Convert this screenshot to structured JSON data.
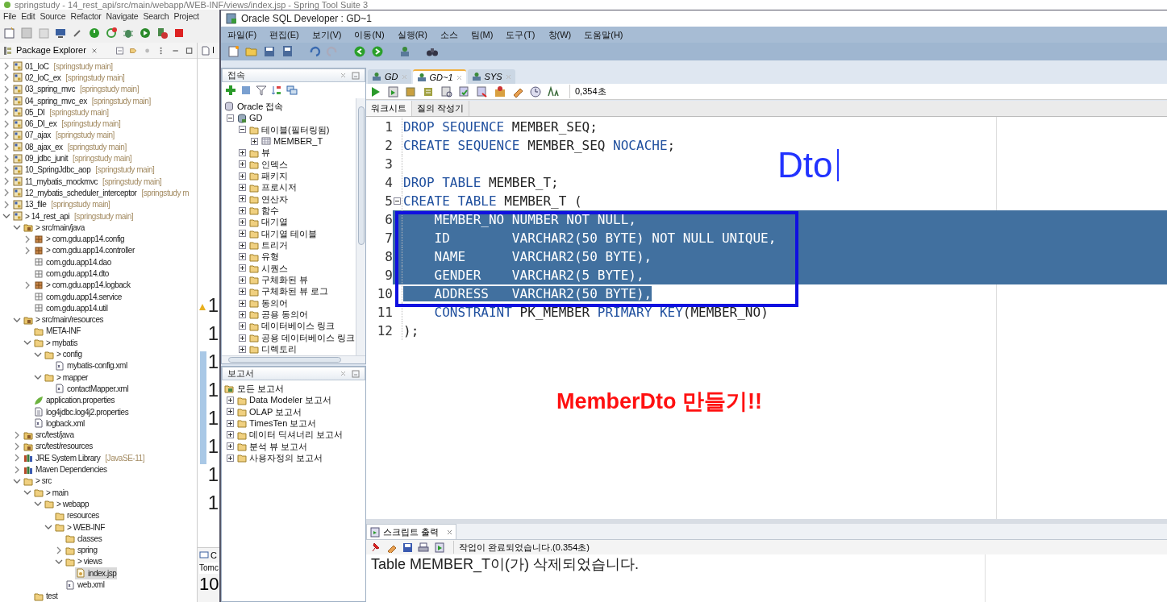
{
  "sts": {
    "title": "springstudy - 14_rest_api/src/main/webapp/WEB-INF/views/index.jsp - Spring Tool Suite 3",
    "menu": [
      "File",
      "Edit",
      "Source",
      "Refactor",
      "Navigate",
      "Search",
      "Project"
    ],
    "explorer_tab": "Package Explorer",
    "tree": [
      {
        "label": "01_IoC",
        "decoration": "[springstudy main]",
        "kind": "project",
        "expanded": false,
        "selected": false
      },
      {
        "label": "02_IoC_ex",
        "decoration": "[springstudy main]",
        "kind": "project",
        "expanded": false,
        "selected": false
      },
      {
        "label": "03_spring_mvc",
        "decoration": "[springstudy main]",
        "kind": "project",
        "expanded": false,
        "selected": false
      },
      {
        "label": "04_spring_mvc_ex",
        "decoration": "[springstudy main]",
        "kind": "project",
        "expanded": false,
        "selected": false
      },
      {
        "label": "05_DI",
        "decoration": "[springstudy main]",
        "kind": "project",
        "expanded": false,
        "selected": false
      },
      {
        "label": "06_DI_ex",
        "decoration": "[springstudy main]",
        "kind": "project",
        "expanded": false,
        "selected": false
      },
      {
        "label": "07_ajax",
        "decoration": "[springstudy main]",
        "kind": "project",
        "expanded": false,
        "selected": false
      },
      {
        "label": "08_ajax_ex",
        "decoration": "[springstudy main]",
        "kind": "project",
        "expanded": false,
        "selected": false
      },
      {
        "label": "09_jdbc_junit",
        "decoration": "[springstudy main]",
        "kind": "project",
        "expanded": false,
        "selected": false
      },
      {
        "label": "10_SpringJdbc_aop",
        "decoration": "[springstudy main]",
        "kind": "project",
        "expanded": false,
        "selected": false
      },
      {
        "label": "11_mybatis_mockmvc",
        "decoration": "[springstudy main]",
        "kind": "project",
        "expanded": false,
        "selected": false
      },
      {
        "label": "12_mybatis_scheduler_interceptor",
        "decoration": "[springstudy m",
        "kind": "project",
        "expanded": false,
        "selected": false
      },
      {
        "label": "13_file",
        "decoration": "[springstudy main]",
        "kind": "project",
        "expanded": false,
        "selected": false
      },
      {
        "label": "> 14_rest_api",
        "decoration": "[springstudy main]",
        "kind": "project",
        "expanded": true,
        "selected": false,
        "children": [
          {
            "label": "> src/main/java",
            "kind": "source-folder",
            "expanded": true,
            "selected": false,
            "children": [
              {
                "label": "> com.gdu.app14.config",
                "kind": "package",
                "expanded": false,
                "selected": false
              },
              {
                "label": "> com.gdu.app14.controller",
                "kind": "package",
                "expanded": false,
                "selected": false
              },
              {
                "label": "com.gdu.app14.dao",
                "kind": "package-empty",
                "selected": false
              },
              {
                "label": "com.gdu.app14.dto",
                "kind": "package-empty",
                "selected": false
              },
              {
                "label": "> com.gdu.app14.logback",
                "kind": "package",
                "expanded": false,
                "selected": false
              },
              {
                "label": "com.gdu.app14.service",
                "kind": "package-empty",
                "selected": false
              },
              {
                "label": "com.gdu.app14.util",
                "kind": "package-empty",
                "selected": false
              }
            ]
          },
          {
            "label": "> src/main/resources",
            "kind": "source-folder",
            "expanded": true,
            "selected": false,
            "children": [
              {
                "label": "META-INF",
                "kind": "folder",
                "selected": false
              },
              {
                "label": "> mybatis",
                "kind": "folder",
                "expanded": true,
                "selected": false,
                "children": [
                  {
                    "label": "> config",
                    "kind": "folder",
                    "expanded": true,
                    "selected": false,
                    "children": [
                      {
                        "label": "mybatis-config.xml",
                        "kind": "xml",
                        "selected": false
                      }
                    ]
                  },
                  {
                    "label": "> mapper",
                    "kind": "folder",
                    "expanded": true,
                    "selected": false,
                    "children": [
                      {
                        "label": "contactMapper.xml",
                        "kind": "xml",
                        "selected": false
                      }
                    ]
                  }
                ]
              },
              {
                "label": "application.properties",
                "kind": "spring",
                "selected": false
              },
              {
                "label": "log4jdbc.log4j2.properties",
                "kind": "properties",
                "selected": false
              },
              {
                "label": "logback.xml",
                "kind": "xml",
                "selected": false
              }
            ]
          },
          {
            "label": "src/test/java",
            "kind": "source-folder",
            "expanded": false,
            "selected": false
          },
          {
            "label": "src/test/resources",
            "kind": "source-folder",
            "expanded": false,
            "selected": false
          },
          {
            "label": "JRE System Library",
            "decoration": "[JavaSE-11]",
            "kind": "library",
            "expanded": false,
            "selected": false
          },
          {
            "label": "Maven Dependencies",
            "kind": "library",
            "expanded": false,
            "selected": false
          },
          {
            "label": "> src",
            "kind": "folder",
            "expanded": true,
            "selected": false,
            "children": [
              {
                "label": "> main",
                "kind": "folder",
                "expanded": true,
                "selected": false,
                "children": [
                  {
                    "label": "> webapp",
                    "kind": "folder",
                    "expanded": true,
                    "selected": false,
                    "children": [
                      {
                        "label": "resources",
                        "kind": "folder",
                        "selected": false
                      },
                      {
                        "label": "> WEB-INF",
                        "kind": "folder",
                        "expanded": true,
                        "selected": false,
                        "children": [
                          {
                            "label": "classes",
                            "kind": "folder",
                            "selected": false
                          },
                          {
                            "label": "spring",
                            "kind": "folder",
                            "expanded": false,
                            "selected": false
                          },
                          {
                            "label": "> views",
                            "kind": "folder",
                            "expanded": true,
                            "selected": false,
                            "children": [
                              {
                                "label": "index.jsp",
                                "kind": "jsp",
                                "selected": true
                              }
                            ]
                          },
                          {
                            "label": "web.xml",
                            "kind": "xml",
                            "selected": false
                          }
                        ]
                      }
                    ]
                  }
                ]
              },
              {
                "label": "test",
                "kind": "folder",
                "selected": false
              }
            ]
          }
        ]
      }
    ],
    "editor_tab": "I",
    "gutter_numbers": [
      "1",
      "1",
      "1",
      "1",
      "1",
      "1",
      "1",
      "1"
    ],
    "console_view_tab": "C",
    "console_tab": "Tomc",
    "console_text": "10"
  },
  "sql": {
    "title": "Oracle SQL Developer : GD~1",
    "menu": [
      "파일(F)",
      "편집(E)",
      "보기(V)",
      "이동(N)",
      "실행(R)",
      "소스",
      "팀(M)",
      "도구(T)",
      "창(W)",
      "도움말(H)"
    ],
    "connections": {
      "title": "접속",
      "root": "Oracle 접속",
      "tree": [
        {
          "label": "GD",
          "kind": "connection",
          "expanded": true,
          "selected": false,
          "children": [
            {
              "label": "테이블(필터링됨)",
              "kind": "folder",
              "expanded": true,
              "selected": false,
              "children": [
                {
                  "label": "MEMBER_T",
                  "kind": "table",
                  "expanded": false,
                  "selected": false
                }
              ]
            },
            {
              "label": "뷰",
              "kind": "folder",
              "expanded": false,
              "selected": false
            },
            {
              "label": "인덱스",
              "kind": "folder",
              "expanded": false,
              "selected": false
            },
            {
              "label": "패키지",
              "kind": "folder",
              "expanded": false,
              "selected": false
            },
            {
              "label": "프로시저",
              "kind": "folder",
              "expanded": false,
              "selected": false
            },
            {
              "label": "연산자",
              "kind": "folder",
              "expanded": false,
              "selected": false
            },
            {
              "label": "함수",
              "kind": "folder",
              "expanded": false,
              "selected": false
            },
            {
              "label": "대기열",
              "kind": "folder",
              "expanded": false,
              "selected": false
            },
            {
              "label": "대기열 테이블",
              "kind": "folder",
              "expanded": false,
              "selected": false
            },
            {
              "label": "트리거",
              "kind": "folder",
              "expanded": false,
              "selected": false
            },
            {
              "label": "유형",
              "kind": "folder",
              "expanded": false,
              "selected": false
            },
            {
              "label": "시퀀스",
              "kind": "folder",
              "expanded": false,
              "selected": false
            },
            {
              "label": "구체화된 뷰",
              "kind": "folder",
              "expanded": false,
              "selected": false
            },
            {
              "label": "구체화된 뷰 로그",
              "kind": "folder",
              "expanded": false,
              "selected": false
            },
            {
              "label": "동의어",
              "kind": "folder",
              "expanded": false,
              "selected": false
            },
            {
              "label": "공용 동의어",
              "kind": "folder",
              "expanded": false,
              "selected": false
            },
            {
              "label": "데이터베이스 링크",
              "kind": "folder",
              "expanded": false,
              "selected": false
            },
            {
              "label": "공용 데이터베이스 링크",
              "kind": "folder",
              "expanded": false,
              "selected": false
            },
            {
              "label": "디렉토리",
              "kind": "folder",
              "expanded": false,
              "selected": false
            }
          ]
        }
      ]
    },
    "reports": {
      "title": "보고서",
      "root": "모든 보고서",
      "tree": [
        {
          "label": "Data Modeler 보고서",
          "kind": "folder",
          "expanded": false,
          "selected": false
        },
        {
          "label": "OLAP 보고서",
          "kind": "folder",
          "expanded": false,
          "selected": false
        },
        {
          "label": "TimesTen 보고서",
          "kind": "folder",
          "expanded": false,
          "selected": false
        },
        {
          "label": "데이터 딕셔너리 보고서",
          "kind": "folder",
          "expanded": false,
          "selected": false
        },
        {
          "label": "분석 뷰 보고서",
          "kind": "folder",
          "expanded": false,
          "selected": false
        },
        {
          "label": "사용자정의 보고서",
          "kind": "folder",
          "expanded": false,
          "selected": false
        }
      ]
    },
    "tabs": [
      {
        "label": "GD",
        "selected": false
      },
      {
        "label": "GD~1",
        "selected": true
      },
      {
        "label": "SYS",
        "selected": false
      }
    ],
    "elapsed": "0,354초",
    "subtabs": [
      {
        "label": "워크시트",
        "selected": true
      },
      {
        "label": "질의 작성기",
        "selected": false
      }
    ],
    "code": [
      {
        "number": "1",
        "selected": false,
        "tokens": [
          {
            "t": "DROP SEQUENCE",
            "kind": "keyword"
          },
          {
            "t": " MEMBER_SEQ;",
            "kind": "plain"
          }
        ]
      },
      {
        "number": "2",
        "selected": false,
        "tokens": [
          {
            "t": "CREATE SEQUENCE",
            "kind": "keyword"
          },
          {
            "t": " MEMBER_SEQ ",
            "kind": "plain"
          },
          {
            "t": "NOCACHE",
            "kind": "keyword"
          },
          {
            "t": ";",
            "kind": "plain"
          }
        ]
      },
      {
        "number": "3",
        "selected": false
      },
      {
        "number": "4",
        "selected": false,
        "tokens": [
          {
            "t": "DROP TABLE",
            "kind": "keyword"
          },
          {
            "t": " MEMBER_T;",
            "kind": "plain"
          }
        ]
      },
      {
        "number": "5",
        "selected": false,
        "fold_marker": true,
        "tokens": [
          {
            "t": "CREATE TABLE",
            "kind": "keyword"
          },
          {
            "t": " MEMBER_T (",
            "kind": "plain"
          }
        ]
      },
      {
        "number": "6",
        "selected": true,
        "tokens": [
          {
            "t": "    MEMBER_NO NUMBER NOT NULL,"
          }
        ]
      },
      {
        "number": "7",
        "selected": true,
        "tokens": [
          {
            "t": "    ID        VARCHAR2(50 BYTE) NOT NULL UNIQUE,"
          }
        ]
      },
      {
        "number": "8",
        "selected": true,
        "tokens": [
          {
            "t": "    NAME      VARCHAR2(50 BYTE),"
          }
        ]
      },
      {
        "number": "9",
        "selected": true,
        "tokens": [
          {
            "t": "    GENDER    VARCHAR2(5 BYTE),"
          }
        ]
      },
      {
        "number": "10",
        "selected": true,
        "tokens": [
          {
            "t": "    ADDRESS   VARCHAR2(50 BYTE),"
          }
        ]
      },
      {
        "number": "11",
        "selected": false,
        "tokens": [
          {
            "t": "    CONSTRAINT",
            "kind": "keyword"
          },
          {
            "t": " PK_MEMBER ",
            "kind": "plain"
          },
          {
            "t": "PRIMARY KEY",
            "kind": "keyword"
          },
          {
            "t": "(MEMBER_NO)",
            "kind": "plain"
          }
        ]
      },
      {
        "number": "12",
        "selected": false,
        "tokens": [
          {
            "t": ");",
            "kind": "plain"
          }
        ]
      }
    ],
    "annotations": {
      "typed_text": "Dto",
      "caption": "MemberDto 만들기!!"
    },
    "output": {
      "tab": "스크립트 출력",
      "status": "작업이 완료되었습니다.(0.354초)",
      "text": "Table MEMBER_T이(가) 삭제되었습니다."
    }
  }
}
